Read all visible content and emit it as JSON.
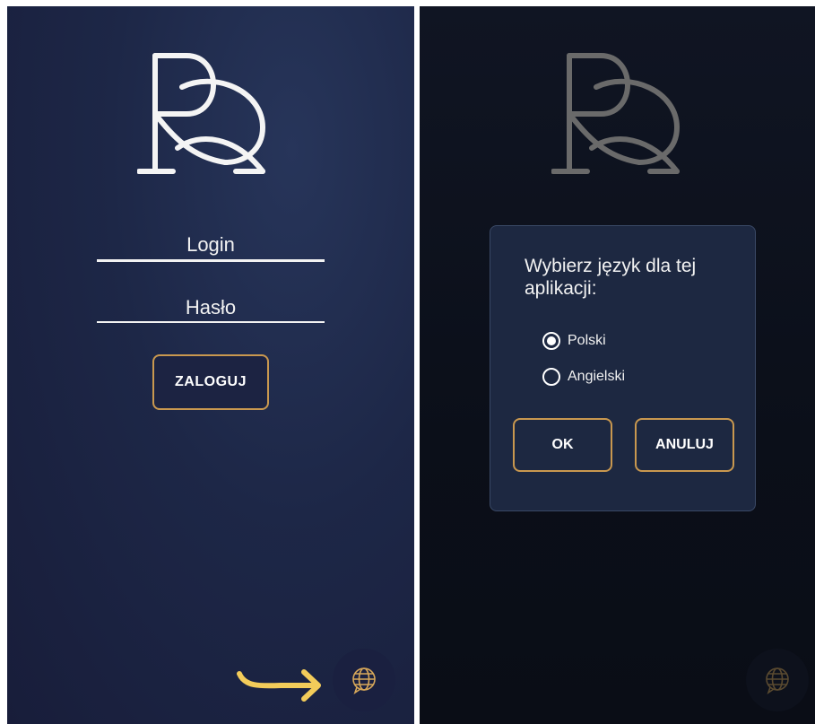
{
  "login_screen": {
    "login_label": "Login",
    "password_label": "Hasło",
    "login_button": "ZALOGUJ",
    "language_button_icon": "globe-chat-icon",
    "logo_icon": "pq-monogram-logo"
  },
  "language_dialog": {
    "title": "Wybierz język dla tej aplikacji:",
    "options": [
      {
        "label": "Polski",
        "selected": true
      },
      {
        "label": "Angielski",
        "selected": false
      }
    ],
    "ok_label": "OK",
    "cancel_label": "ANULUJ"
  },
  "colors": {
    "accent_gold": "#c9984f",
    "arrow_yellow": "#f3cc5a",
    "login_bg": "#1d2747",
    "dialog_bg": "#1d2841"
  }
}
